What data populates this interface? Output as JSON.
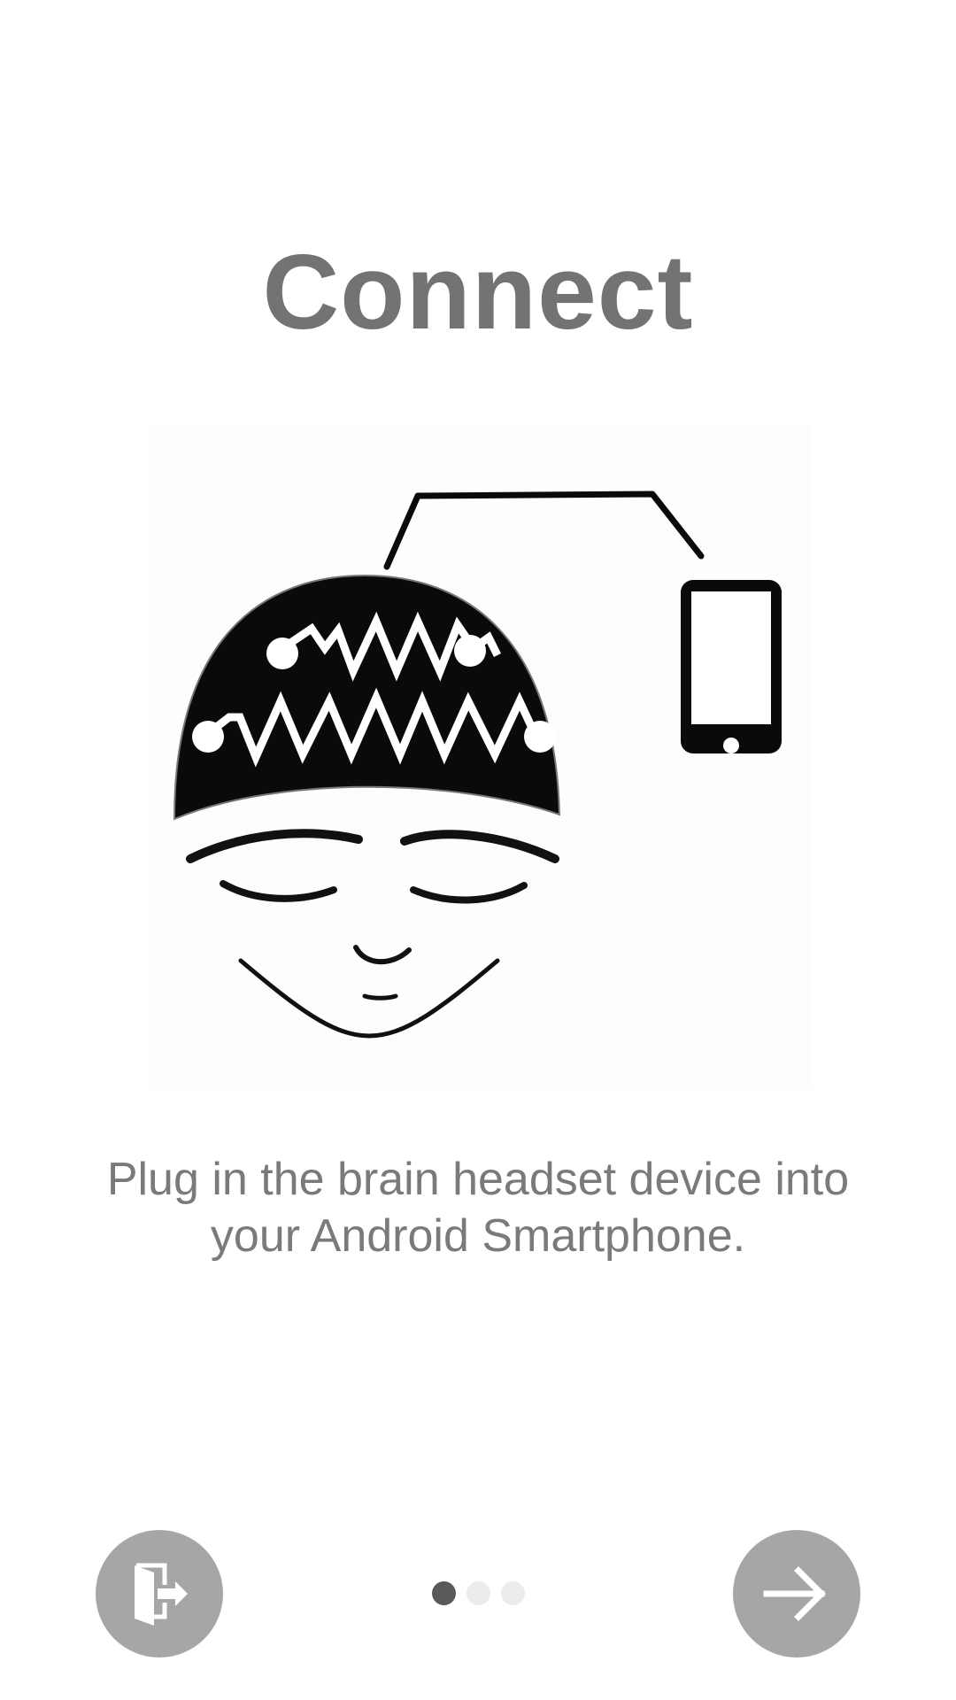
{
  "onboarding": {
    "title": "Connect",
    "description_line1": "Plug in the brain headset device into",
    "description_line2": "your Android Smartphone.",
    "illustration_icon": "brain-headset-phone-illustration",
    "page_indicator": {
      "total_pages": 3,
      "current_page": 1
    },
    "exit_button_icon": "exit-door-icon",
    "next_button_icon": "arrow-right-icon"
  },
  "colors": {
    "title": "#737373",
    "description": "#7a7a7a",
    "button_background": "#a6a6a6",
    "dot_active": "#595959",
    "dot_inactive": "#ececec"
  }
}
